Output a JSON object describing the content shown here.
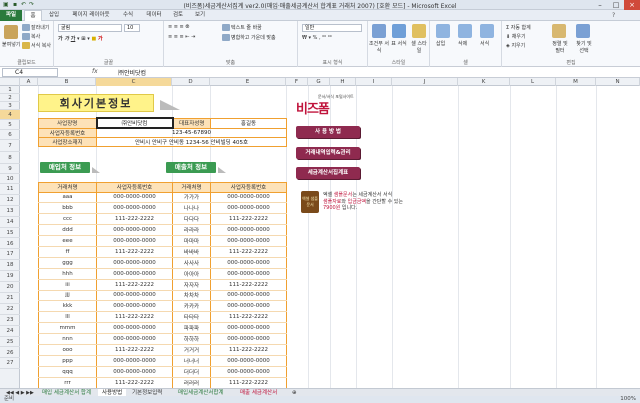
{
  "window": {
    "title": "(비즈폼)세금계산서집계 ver2.0(매입·매출세금계산서 합계표 거래처 2007) [호환 모드] - Microsoft Excel"
  },
  "ribbon": {
    "tabs": [
      "파일",
      "홈",
      "삽입",
      "페이지 레이아웃",
      "수식",
      "데이터",
      "검토",
      "보기"
    ],
    "clipboard": {
      "paste": "붙여넣기",
      "cut": "잘라내기",
      "copy": "복사",
      "format_painter": "서식 복사",
      "label": "클립보드"
    },
    "font": {
      "name": "굴림",
      "size": "10",
      "label": "글꼴"
    },
    "alignment": {
      "wrap": "텍스트 줄 바꿈",
      "merge": "병합하고 가운데 맞춤",
      "label": "맞춤"
    },
    "number": {
      "format": "일반",
      "label": "표시 형식"
    },
    "styles": {
      "conditional": "조건부 서식",
      "table": "표 서식",
      "cell": "셀 스타일",
      "label": "스타일"
    },
    "cells": {
      "insert": "삽입",
      "delete": "삭제",
      "format": "서식",
      "label": "셀"
    },
    "editing": {
      "autosum": "자동 합계",
      "fill": "채우기",
      "clear": "지우기",
      "sort": "정렬 및 필터",
      "find": "찾기 및 선택",
      "label": "편집"
    }
  },
  "formula_bar": {
    "cell": "C4",
    "fx": "fx",
    "value": "㈜안비닷컴"
  },
  "columns": [
    "A",
    "B",
    "C",
    "D",
    "E",
    "F",
    "G",
    "H",
    "I",
    "J",
    "K",
    "L",
    "M",
    "N"
  ],
  "rows": [
    "1",
    "2",
    "3",
    "4",
    "5",
    "6",
    "7",
    "8",
    "9",
    "10",
    "11",
    "12",
    "13",
    "14",
    "15",
    "16",
    "17",
    "18",
    "19",
    "20",
    "21",
    "22",
    "23",
    "24",
    "25",
    "26",
    "27"
  ],
  "sheet": {
    "title": "회사기본정보",
    "info_headers": [
      "사업장명",
      "대표자성명"
    ],
    "company_name": "㈜안비닷컴",
    "ceo": "홍길동",
    "reg_label": "사업자등록번호",
    "reg_no": "123-45-67890",
    "addr_label": "사업장소재지",
    "address": "안비시 안비구 안비동 1234-56 안비빌딩 405호",
    "purchase_tag": "매입처 정보",
    "sales_tag": "매출처 정보",
    "list_headers": [
      "거래처명",
      "사업자등록번호",
      "거래처명",
      "사업자등록번호"
    ],
    "purchase": [
      [
        "aaa",
        "000-0000-0000"
      ],
      [
        "bbb",
        "000-0000-0000"
      ],
      [
        "ccc",
        "111-222-2222"
      ],
      [
        "ddd",
        "000-0000-0000"
      ],
      [
        "eee",
        "000-0000-0000"
      ],
      [
        "ff",
        "111-222-2222"
      ],
      [
        "ggg",
        "000-0000-0000"
      ],
      [
        "hhh",
        "000-0000-0000"
      ],
      [
        "iii",
        "111-222-2222"
      ],
      [
        "jjj",
        "000-0000-0000"
      ],
      [
        "kkk",
        "000-0000-0000"
      ],
      [
        "lll",
        "111-222-2222"
      ],
      [
        "mmm",
        "000-0000-0000"
      ],
      [
        "nnn",
        "000-0000-0000"
      ],
      [
        "ooo",
        "111-222-2222"
      ],
      [
        "ppp",
        "000-0000-0000"
      ],
      [
        "qqq",
        "000-0000-0000"
      ],
      [
        "rrr",
        "111-222-2222"
      ]
    ],
    "sales": [
      [
        "가가가",
        "000-0000-0000"
      ],
      [
        "나나나",
        "000-0000-0000"
      ],
      [
        "다다다",
        "111-222-2222"
      ],
      [
        "라라라",
        "000-0000-0000"
      ],
      [
        "마마마",
        "000-0000-0000"
      ],
      [
        "바바바",
        "111-222-2222"
      ],
      [
        "사사사",
        "000-0000-0000"
      ],
      [
        "아아아",
        "000-0000-0000"
      ],
      [
        "자자자",
        "111-222-2222"
      ],
      [
        "차차차",
        "000-0000-0000"
      ],
      [
        "카카카",
        "000-0000-0000"
      ],
      [
        "타타타",
        "111-222-2222"
      ],
      [
        "파파파",
        "000-0000-0000"
      ],
      [
        "하하하",
        "000-0000-0000"
      ],
      [
        "거거거",
        "111-222-2222"
      ],
      [
        "너너너",
        "000-0000-0000"
      ],
      [
        "더더더",
        "000-0000-0000"
      ],
      [
        "러러러",
        "111-222-2222"
      ]
    ],
    "logo": {
      "main": "비즈폼",
      "sub": "문서/서식 포털사이트"
    },
    "buttons": [
      "사 용 방 법",
      "거래내역입력&관리",
      "세금계산서집계표"
    ],
    "notice": {
      "icon": "엑셀 샘플문서",
      "line1a": "엑셀 ",
      "line1b": "샘플문서",
      "line1c": "는 세금계산서 서식",
      "line2a": "샘플자료",
      "line2b": "와 ",
      "line2c": "입금금액",
      "line2d": "을 간단할 수 있는",
      "line3a": "7900원",
      "line3b": " 입니다."
    }
  },
  "sheet_tabs": [
    "매입 세금계산서 합계",
    "사용방법",
    "기본정보입력",
    "매입세금계산서합계",
    "매출 세금계산서"
  ],
  "status": {
    "text": "준비",
    "zoom": "100%"
  }
}
